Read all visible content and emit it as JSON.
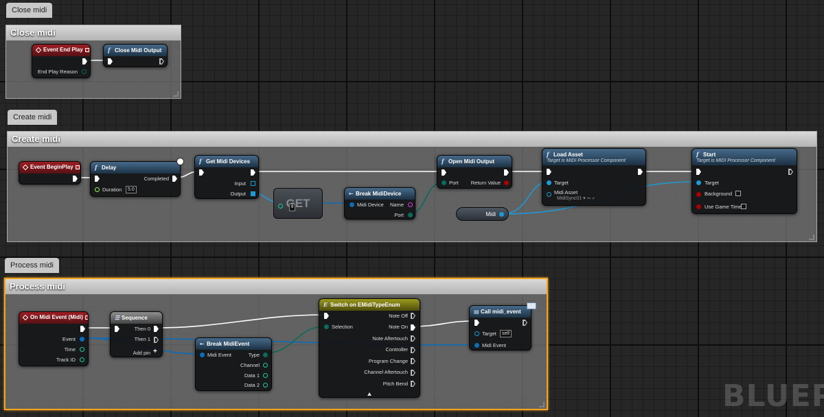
{
  "comments": {
    "close_midi": {
      "tab": "Close midi",
      "title": "Close midi"
    },
    "create_midi": {
      "tab": "Create midi",
      "title": "Create midi"
    },
    "process_midi": {
      "tab": "Process midi",
      "title": "Process midi"
    }
  },
  "nodes": {
    "event_end_play": {
      "title": "Event End Play",
      "end_play_reason": "End Play Reason"
    },
    "close_midi_output": {
      "title": "Close Midi Output",
      "icon": "f"
    },
    "event_begin_play": {
      "title": "Event BeginPlay"
    },
    "delay": {
      "title": "Delay",
      "icon": "f",
      "completed": "Completed",
      "duration": "Duration",
      "duration_value": "5.0"
    },
    "get_midi_devices": {
      "title": "Get Midi Devices",
      "icon": "f",
      "input": "Input",
      "output": "Output"
    },
    "get": {
      "title": "GET",
      "index_value": "0"
    },
    "break_midi_device": {
      "title": "Break MidiDevice",
      "midi_device": "Midi Device",
      "name": "Name",
      "port": "Port"
    },
    "open_midi_output": {
      "title": "Open Midi Output",
      "icon": "f",
      "port": "Port",
      "return_value": "Return Value"
    },
    "midi_var": {
      "label": "Midi"
    },
    "load_asset": {
      "title": "Load Asset",
      "subtitle": "Target is MIDI Processor Component",
      "icon": "f",
      "target": "Target",
      "midi_asset": "Midi Asset",
      "midi_asset_value": "MidiSync01"
    },
    "start": {
      "title": "Start",
      "subtitle": "Target is MIDI Processor Component",
      "icon": "f",
      "target": "Target",
      "background": "Background",
      "use_game_time": "Use Game Time"
    },
    "on_midi_event": {
      "title": "On Midi Event (Midi)",
      "event": "Event",
      "time": "Time",
      "track_id": "Track ID"
    },
    "sequence": {
      "title": "Sequence",
      "then0": "Then 0",
      "then1": "Then 1",
      "add_pin": "Add pin"
    },
    "break_midi_event": {
      "title": "Break MidiEvent",
      "midi_event": "Midi Event",
      "type": "Type",
      "channel": "Channel",
      "data1": "Data 1",
      "data2": "Data 2"
    },
    "switch": {
      "title": "Switch on EMidiTypeEnum",
      "selection": "Selection",
      "outputs": [
        "Note Off",
        "Note On",
        "Note Aftertouch",
        "Controller",
        "Program Change",
        "Channel Aftertouch",
        "Pitch Bend"
      ]
    },
    "call_midi_event": {
      "title": "Call midi_event",
      "target": "Target",
      "target_value": "self",
      "midi_event": "Midi Event"
    }
  },
  "watermark": "BLUEP",
  "colors": {
    "exec": "#ffffff",
    "object": "#1d9ad6",
    "struct": "#0b6cb8",
    "byte": "#0a6b5a",
    "int": "#1ec9a0",
    "float": "#9af45a",
    "bool": "#a00",
    "string": "#e036e0",
    "event_header": "#8b1b20",
    "func_header": "#34546f",
    "switch_header": "#8f8d18",
    "selection": "#f3a51f"
  },
  "icons": {
    "event": "event-diamond-icon",
    "function": "function-f-icon",
    "latent": "clock-icon",
    "message": "envelope-icon",
    "sequence": "sequence-icon",
    "struct_break": "break-struct-icon"
  }
}
